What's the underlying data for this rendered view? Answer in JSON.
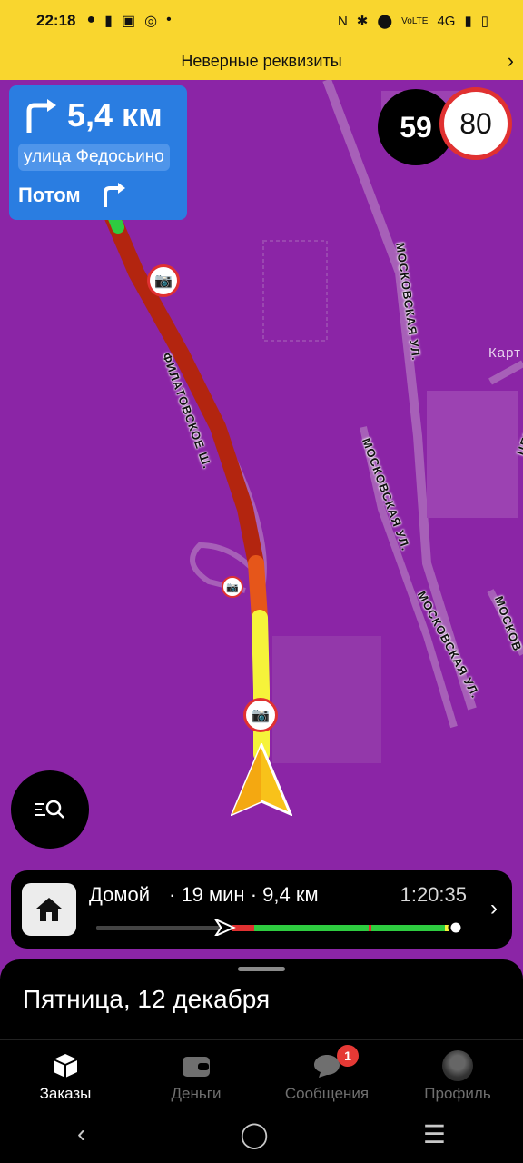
{
  "status_bar": {
    "time": "22:18",
    "left_icons": [
      "chat-bubble-icon",
      "battery-saver-icon",
      "qr-icon",
      "check-circle-icon",
      "dot-icon"
    ],
    "right_icons": [
      "nfc-icon",
      "bluetooth-icon",
      "location-icon",
      "volte-icon",
      "4g-icon",
      "signal-icon",
      "battery-icon"
    ],
    "network": "4G"
  },
  "banner": {
    "text": "Неверные реквизиты",
    "chevron_icon": "chevron-right-icon"
  },
  "navigation": {
    "distance": "5,4 км",
    "street": "улица Федосьино",
    "then_label": "Потом",
    "maneuver_icon": "turn-right-icon"
  },
  "speed": {
    "current": "59",
    "limit": "80"
  },
  "map": {
    "street_labels": [
      "ФИЛАТОВСКОЕ Ш.",
      "МОСКОВСКАЯ УЛ.",
      "МОСКОВСКАЯ УЛ.",
      "МОСКОВСКАЯ УЛ.",
      "МОСКОВ",
      "ЦЕНТ",
      "Карт"
    ],
    "camera_icon": "speed-camera-icon",
    "vehicle_icon": "navigation-arrow-icon",
    "background_color": "#8b25a6"
  },
  "route": {
    "destination": "Домой",
    "time": "· 19 мин ·",
    "distance": "9,4 км",
    "eta": "1:20:35",
    "home_icon": "home-icon",
    "progress": 0.35
  },
  "sheet": {
    "date": "Пятница, 12 декабря"
  },
  "tabs": [
    {
      "label": "Заказы",
      "icon": "box-icon",
      "active": true
    },
    {
      "label": "Деньги",
      "icon": "wallet-icon",
      "active": false
    },
    {
      "label": "Сообщения",
      "icon": "chat-icon",
      "active": false,
      "badge": "1"
    },
    {
      "label": "Профиль",
      "icon": "avatar-icon",
      "active": false
    }
  ],
  "system_nav": [
    "back-icon",
    "home-circle-icon",
    "menu-icon"
  ],
  "colors": {
    "accent_yellow": "#f9d62e",
    "nav_blue": "#2a7de1",
    "traffic_red": "#b3250f",
    "traffic_yellow": "#f6f33a",
    "traffic_green": "#2ecc40"
  }
}
